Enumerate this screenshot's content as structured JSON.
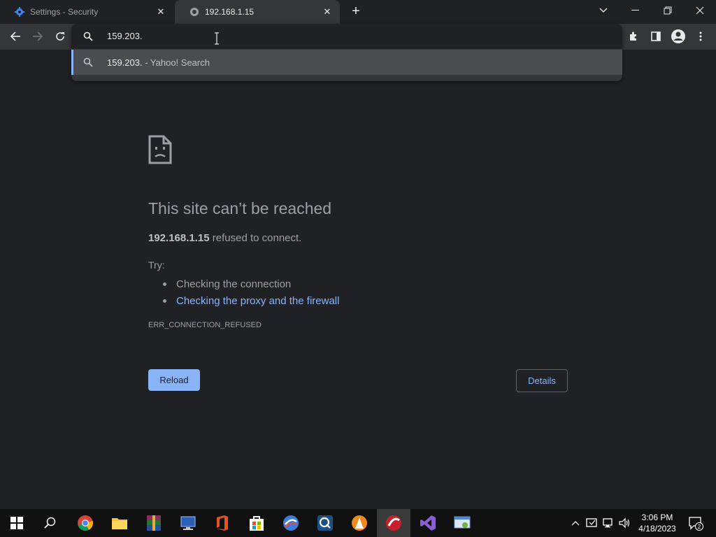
{
  "tabs": [
    {
      "title": "Settings - Security",
      "active": false,
      "icon": "gear-icon"
    },
    {
      "title": "192.168.1.15",
      "active": true,
      "icon": "globe-icon"
    }
  ],
  "omnibox": {
    "value": "159.203.",
    "suggestion": {
      "query": "159.203.",
      "engine": " - Yahoo! Search"
    }
  },
  "error": {
    "title": "This site can’t be reached",
    "host": "192.168.1.15",
    "message": " refused to connect.",
    "try_label": "Try:",
    "suggestions": [
      "Checking the connection",
      "Checking the proxy and the firewall"
    ],
    "code": "ERR_CONNECTION_REFUSED",
    "reload_label": "Reload",
    "details_label": "Details"
  },
  "taskbar": {
    "apps": [
      "windows-start-icon",
      "search-icon",
      "chrome-icon",
      "file-explorer-icon",
      "winrar-icon",
      "remote-desktop-icon",
      "office-icon",
      "store-icon",
      "app-swirl-icon",
      "qbittorrent-icon",
      "vlc-icon",
      "app-red-icon",
      "visual-studio-icon",
      "control-panel-icon"
    ],
    "time": "3:06 PM",
    "date": "4/18/2023",
    "notifications": "2"
  },
  "colors": {
    "accent": "#8ab4f8",
    "background": "#202124",
    "toolbar": "#35363a"
  }
}
